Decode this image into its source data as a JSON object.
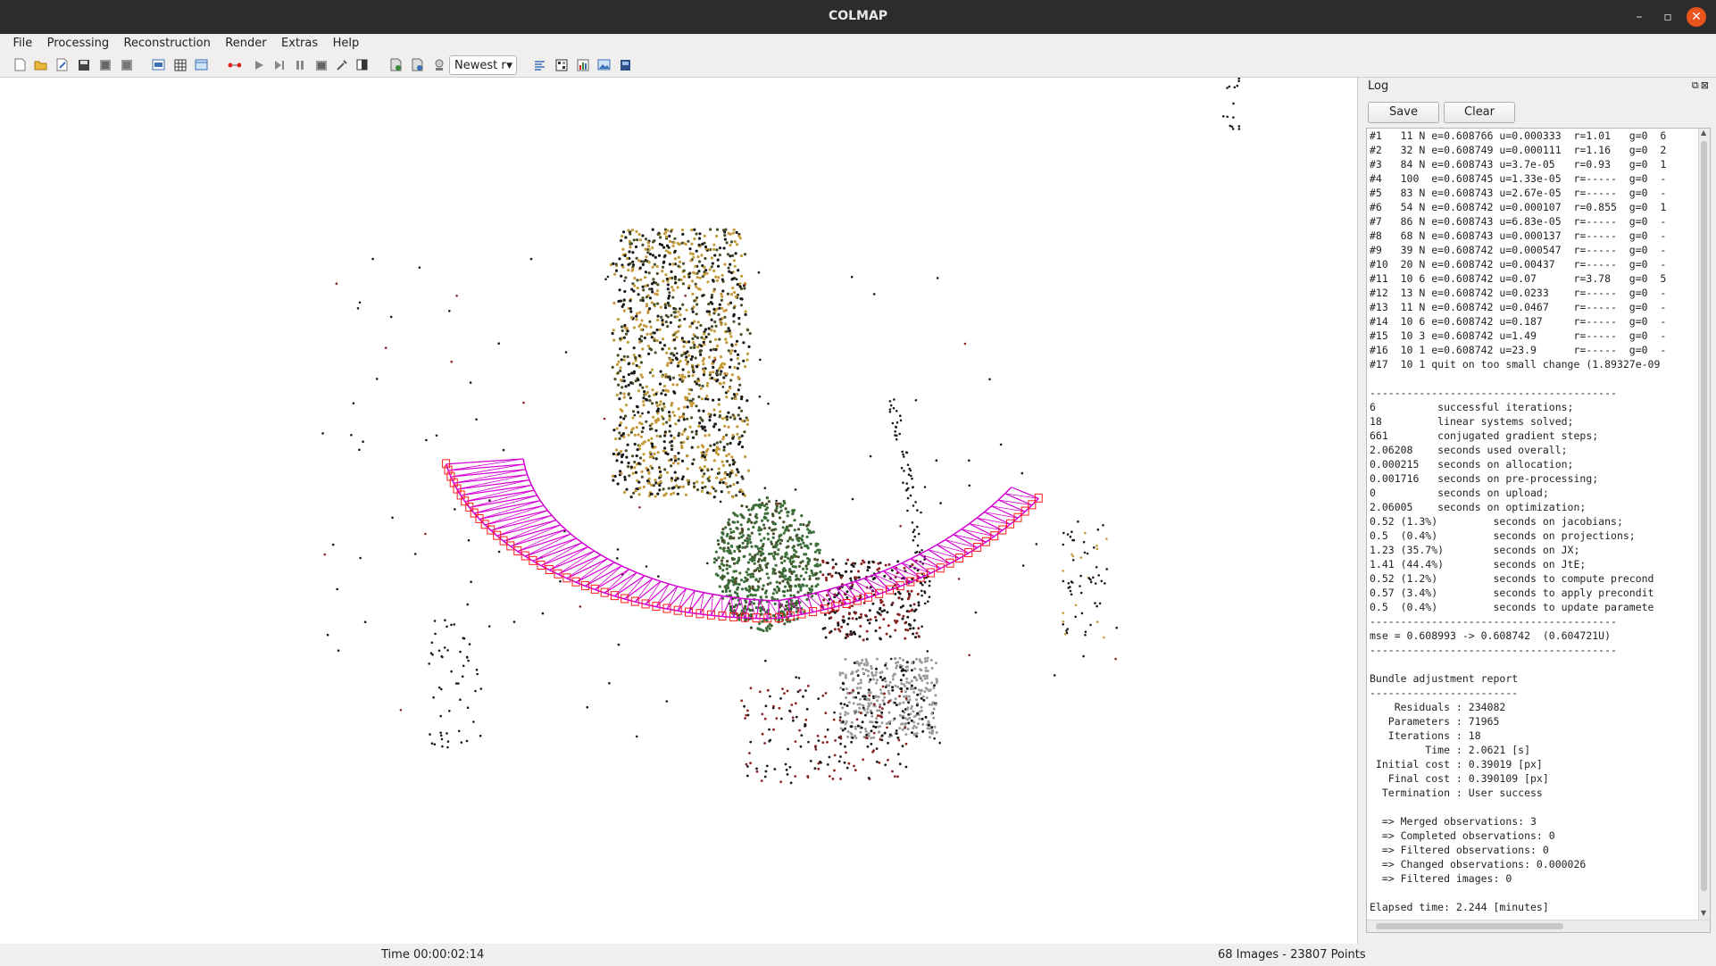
{
  "window": {
    "title": "COLMAP",
    "minimize_glyph": "–",
    "restore_glyph": "▫",
    "close_glyph": "✕"
  },
  "menu": [
    "File",
    "Processing",
    "Reconstruction",
    "Render",
    "Extras",
    "Help"
  ],
  "toolbar": {
    "icons": [
      "new-project-icon",
      "open-project-icon",
      "edit-project-icon",
      "save-project-icon",
      "import-icon",
      "export-icon",
      "feature-extraction-icon",
      "feature-matching-icon",
      "database-icon",
      "reconstruction-start-icon",
      "reconstruction-step-icon",
      "reconstruction-pause-icon",
      "reconstruction-reset-icon",
      "options-icon",
      "tools-icon",
      "color-icon",
      "bundle-adjustment-icon",
      "dense-reconstruction-icon",
      "render-options-icon"
    ],
    "reconstruction_select": "Newest r",
    "right_icons": [
      "log-icon",
      "match-matrix-icon",
      "statistics-icon",
      "image-viewer-icon",
      "grab-image-icon"
    ]
  },
  "viewport": {
    "camera_color": "#ff1a1a",
    "camera_link_color": "#d400d4",
    "point_colors": [
      "#1a1a1a",
      "#4a4f2a",
      "#c49a3a",
      "#3c6e3a",
      "#8a2424",
      "#9a9a9a"
    ]
  },
  "log": {
    "title": "Log",
    "save_label": "Save",
    "clear_label": "Clear",
    "lines": [
      "#1   11 N e=0.608766 u=0.000333  r=1.01   g=0  6",
      "#2   32 N e=0.608749 u=0.000111  r=1.16   g=0  2",
      "#3   84 N e=0.608743 u=3.7e-05   r=0.93   g=0  1",
      "#4   100  e=0.608745 u=1.33e-05  r=-----  g=0  -",
      "#5   83 N e=0.608743 u=2.67e-05  r=-----  g=0  -",
      "#6   54 N e=0.608742 u=0.000107  r=0.855  g=0  1",
      "#7   86 N e=0.608743 u=6.83e-05  r=-----  g=0  -",
      "#8   68 N e=0.608743 u=0.000137  r=-----  g=0  -",
      "#9   39 N e=0.608742 u=0.000547  r=-----  g=0  -",
      "#10  20 N e=0.608742 u=0.00437   r=-----  g=0  -",
      "#11  10 6 e=0.608742 u=0.07      r=3.78   g=0  5",
      "#12  13 N e=0.608742 u=0.0233    r=-----  g=0  -",
      "#13  11 N e=0.608742 u=0.0467    r=-----  g=0  -",
      "#14  10 6 e=0.608742 u=0.187     r=-----  g=0  -",
      "#15  10 3 e=0.608742 u=1.49      r=-----  g=0  -",
      "#16  10 1 e=0.608742 u=23.9      r=-----  g=0  -",
      "#17  10 1 quit on too small change (1.89327e-09",
      "",
      "----------------------------------------",
      "6          successful iterations;",
      "18         linear systems solved;",
      "661        conjugated gradient steps;",
      "2.06208    seconds used overall;",
      "0.000215   seconds on allocation;",
      "0.001716   seconds on pre-processing;",
      "0          seconds on upload;",
      "2.06005    seconds on optimization;",
      "0.52 (1.3%)         seconds on jacobians;",
      "0.5  (0.4%)         seconds on projections;",
      "1.23 (35.7%)        seconds on JX;",
      "1.41 (44.4%)        seconds on JtE;",
      "0.52 (1.2%)         seconds to compute precond",
      "0.57 (3.4%)         seconds to apply precondit",
      "0.5  (0.4%)         seconds to update paramete",
      "----------------------------------------",
      "mse = 0.608993 -> 0.608742  (0.604721U)",
      "----------------------------------------",
      "",
      "Bundle adjustment report",
      "------------------------",
      "    Residuals : 234082",
      "   Parameters : 71965",
      "   Iterations : 18",
      "         Time : 2.0621 [s]",
      " Initial cost : 0.39019 [px]",
      "   Final cost : 0.390109 [px]",
      "  Termination : User success",
      "",
      "  => Merged observations: 3",
      "  => Completed observations: 0",
      "  => Filtered observations: 0",
      "  => Changed observations: 0.000026",
      "  => Filtered images: 0",
      "",
      "Elapsed time: 2.244 [minutes]"
    ]
  },
  "status": {
    "time": "Time 00:00:02:14",
    "summary": "68 Images - 23807 Points"
  }
}
